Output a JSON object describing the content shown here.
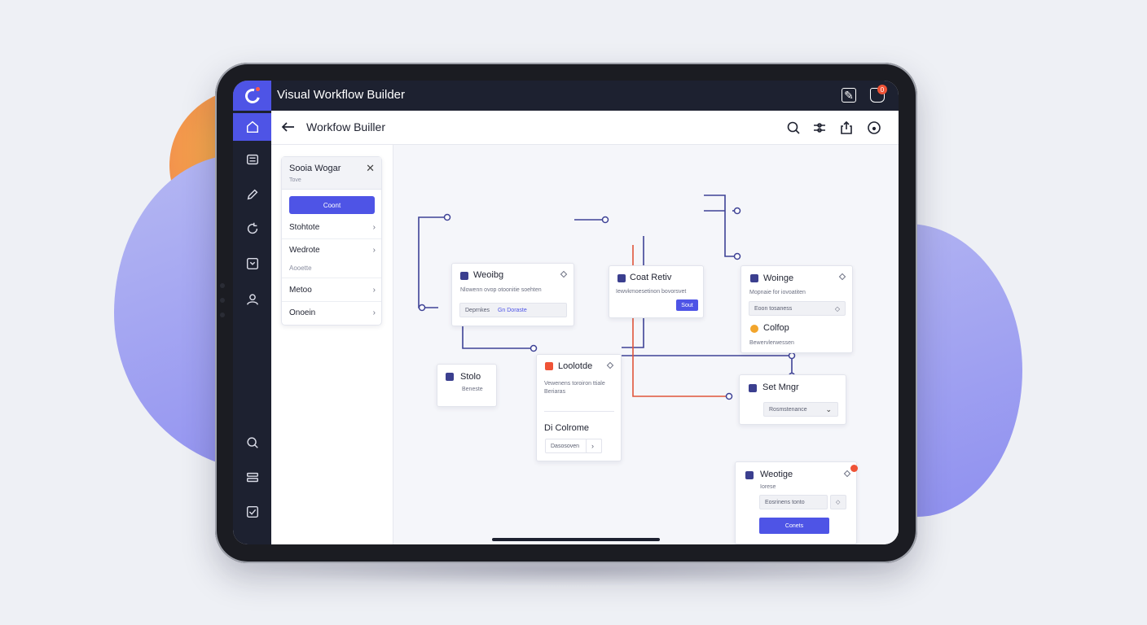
{
  "app": {
    "title": "Visual Workflow Builder",
    "notification_count": "0"
  },
  "header": {
    "title": "Workfow Builler"
  },
  "sidebar_panel": {
    "title": "Sooia Wogar",
    "subtitle": "Tove",
    "button_label": "Coont",
    "items": [
      {
        "label": "Stohtote"
      },
      {
        "label": "Wedrote",
        "note": "Aooette"
      },
      {
        "label": "Metoo"
      },
      {
        "label": "Onoein"
      }
    ]
  },
  "nodes": {
    "weoibg": {
      "title": "Weoibg",
      "desc": "Nlowenn ovop otoonitie soehten",
      "field": "Deprnkes",
      "field_accent": "Gn Doraste"
    },
    "coat_retiv": {
      "title": "Coat Retiv",
      "desc": "Iewvkmoesetinon bovorsvet",
      "button": "Sout"
    },
    "woinge": {
      "title": "Woinge",
      "desc": "Mopnaie for iovoatiten",
      "field": "Eoon tosaness",
      "sub_title": "Colfop",
      "sub_desc": "Bewervlerwessen"
    },
    "stolo": {
      "title": "Stolo",
      "desc": "Beneste"
    },
    "loolotde": {
      "title": "Loolotde",
      "desc_line1": "Vewenens toroiron ttiale",
      "desc_line2": "Beriaras",
      "sub_title": "Di Colrome",
      "field": "Dasosoven"
    },
    "set_mngr": {
      "title": "Set Mngr",
      "field": "Rosmstenance"
    },
    "weotige": {
      "title": "Weotige",
      "desc": "Iorese",
      "field": "Eosrinens tonto",
      "button": "Conets"
    }
  },
  "colors": {
    "accent": "#4e54e6",
    "rail": "#1d2130",
    "wire": "#3e4296",
    "wire_alert": "#e0553b",
    "badge": "#ef5336"
  },
  "icons": {
    "rail": [
      "home-icon",
      "list-icon",
      "pencil-icon",
      "cycle-icon",
      "scan-icon",
      "users-icon",
      "search-icon",
      "stack-icon",
      "check-icon"
    ],
    "header": [
      "search-icon",
      "filter-icon",
      "share-icon",
      "help-icon"
    ],
    "top": [
      "edit-icon",
      "bell-icon"
    ]
  }
}
